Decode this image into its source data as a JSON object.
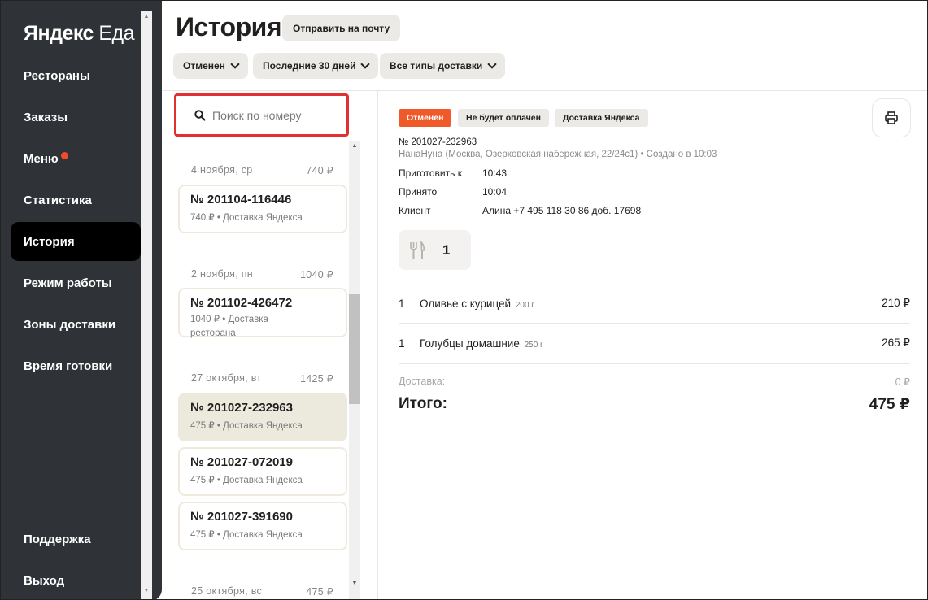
{
  "app": {
    "logo_bold": "Яндекс",
    "logo_rest": " Еда"
  },
  "sidebar": {
    "items": [
      {
        "label": "Рестораны"
      },
      {
        "label": "Заказы"
      },
      {
        "label": "Меню"
      },
      {
        "label": "Статистика"
      },
      {
        "label": "История"
      },
      {
        "label": "Режим работы"
      },
      {
        "label": "Зоны доставки"
      },
      {
        "label": "Время готовки"
      }
    ],
    "bottom_items": [
      {
        "label": "Поддержка"
      },
      {
        "label": "Выход"
      }
    ],
    "active_item": "История"
  },
  "header": {
    "title": "История",
    "send_mail_label": "Отправить на почту"
  },
  "filters": {
    "status": "Отменен",
    "period": "Последние 30 дней",
    "delivery_type": "Все типы доставки"
  },
  "search": {
    "placeholder": "Поиск по номеру"
  },
  "orders": {
    "groups": [
      {
        "date": "4 ноября, ср",
        "total": "740 ₽"
      },
      {
        "date": "2 ноября, пн",
        "total": "1040 ₽"
      },
      {
        "date": "27 октября, вт",
        "total": "1425 ₽"
      },
      {
        "date": "25 октября, вс",
        "total": "475 ₽"
      }
    ],
    "cards": [
      {
        "number": "№ 201104-116446",
        "subtitle": "740 ₽ • Доставка Яндекса"
      },
      {
        "number": "№ 201102-426472",
        "subtitle": "1040 ₽ • Доставка ресторана"
      },
      {
        "number": "№ 201027-232963",
        "subtitle": "475 ₽ • Доставка Яндекса"
      },
      {
        "number": "№ 201027-072019",
        "subtitle": "475 ₽ • Доставка Яндекса"
      },
      {
        "number": "№ 201027-391690",
        "subtitle": "475 ₽ • Доставка Яндекса"
      }
    ],
    "selected_number": "№ 201027-232963"
  },
  "detail": {
    "badges": [
      "Отменен",
      "Не будет оплачен",
      "Доставка Яндекса"
    ],
    "number": "№ 201027-232963",
    "restaurant_line": "НанаНуна (Москва, Озерковская набережная, 22/24с1) • Создано в 10:03",
    "fields": [
      {
        "label": "Приготовить к",
        "value": "10:43"
      },
      {
        "label": "Принято",
        "value": "10:04"
      },
      {
        "label": "Клиент",
        "value": "Алина +7 495 118 30 86 доб. 17698"
      }
    ],
    "cutlery_count": "1",
    "items": [
      {
        "qty": "1",
        "name": "Оливье с курицей",
        "weight": "200 г",
        "price": "210 ₽"
      },
      {
        "qty": "1",
        "name": "Голубцы домашние",
        "weight": "250 г",
        "price": "265 ₽"
      }
    ],
    "delivery_label": "Доставка:",
    "delivery_price": "0 ₽",
    "total_label": "Итого:",
    "total_price": "475 ₽"
  },
  "colors": {
    "sidebar_bg": "#2f3236",
    "active_nav_bg": "#000000",
    "badge_red": "#f05a2a",
    "search_border": "#e03030",
    "selected_card_bg": "#ece9dd",
    "notification_dot": "#f24a2e"
  }
}
